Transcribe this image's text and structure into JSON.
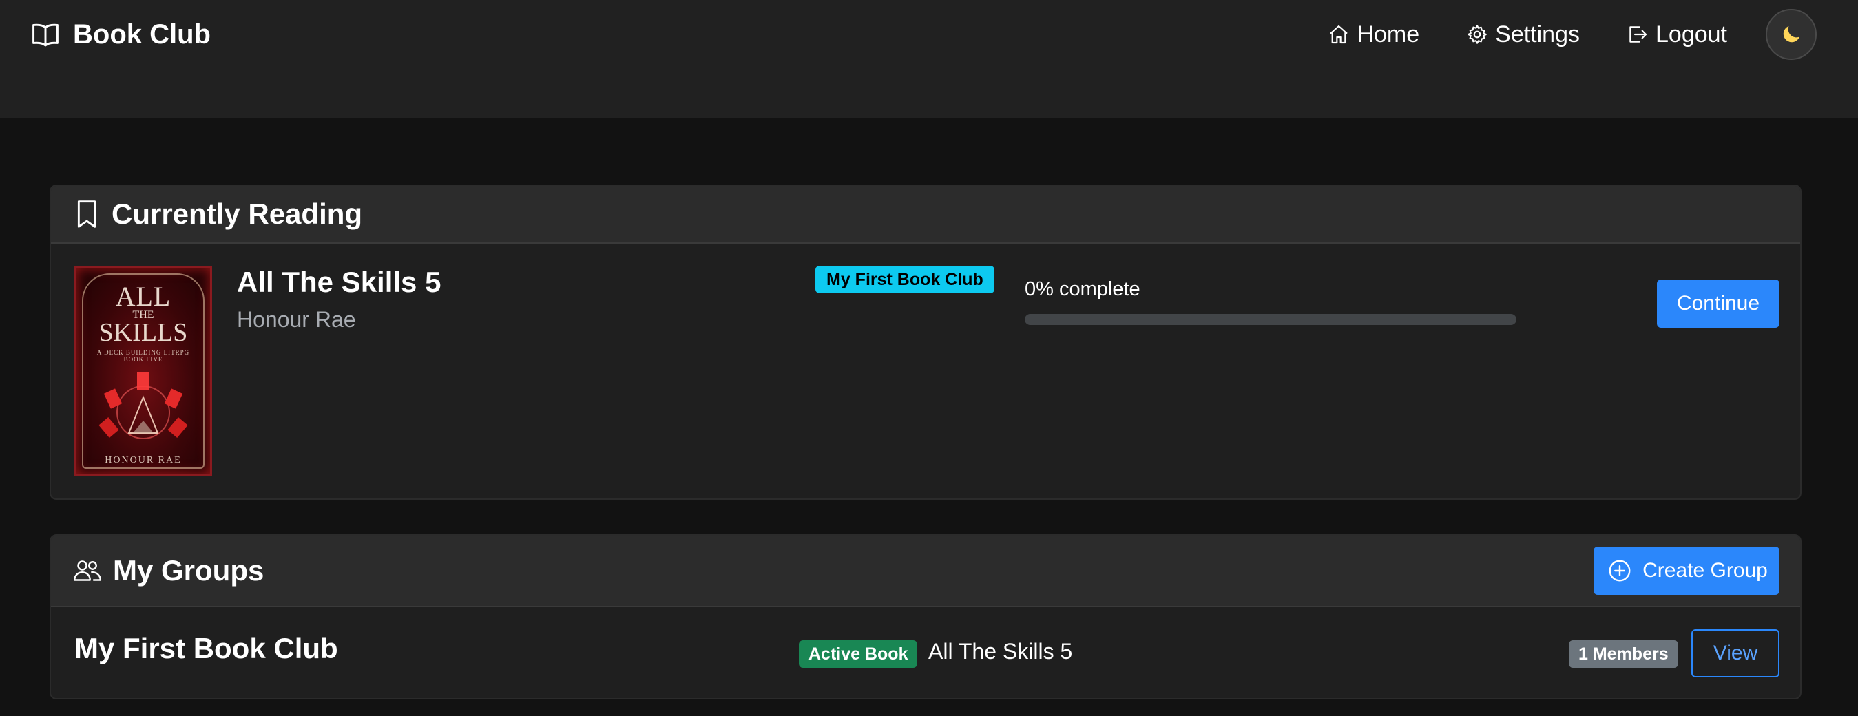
{
  "navbar": {
    "brand": "Book Club",
    "links": [
      {
        "label": "Home",
        "icon": "home-icon"
      },
      {
        "label": "Settings",
        "icon": "gear-icon"
      },
      {
        "label": "Logout",
        "icon": "logout-icon"
      }
    ],
    "theme_toggle_icon": "moon-icon"
  },
  "currently_reading": {
    "title": "Currently Reading",
    "book": {
      "title": "All The Skills 5",
      "author": "Honour Rae",
      "group": "My First Book Club",
      "progress_label": "0% complete",
      "progress_percent": 0,
      "continue_label": "Continue",
      "cover": {
        "line1": "ALL",
        "line2": "THE",
        "line3": "SKILLS",
        "subtitle": "A DECK BUILDING LITRPG",
        "book_number": "BOOK FIVE",
        "author": "HONOUR RAE"
      }
    }
  },
  "my_groups": {
    "title": "My Groups",
    "create_label": "Create Group",
    "groups": [
      {
        "name": "My First Book Club",
        "active_label": "Active Book",
        "active_book": "All The Skills 5",
        "members": "1 Members",
        "view_label": "View"
      }
    ]
  },
  "colors": {
    "primary": "#2b87fb",
    "info": "#0dcaf0",
    "success": "#198754",
    "secondary": "#6c757d",
    "background": "#121212",
    "navbar": "#212121",
    "card": "#1f1f1f",
    "card_header": "#2c2c2c",
    "moon": "#ffd65a"
  }
}
